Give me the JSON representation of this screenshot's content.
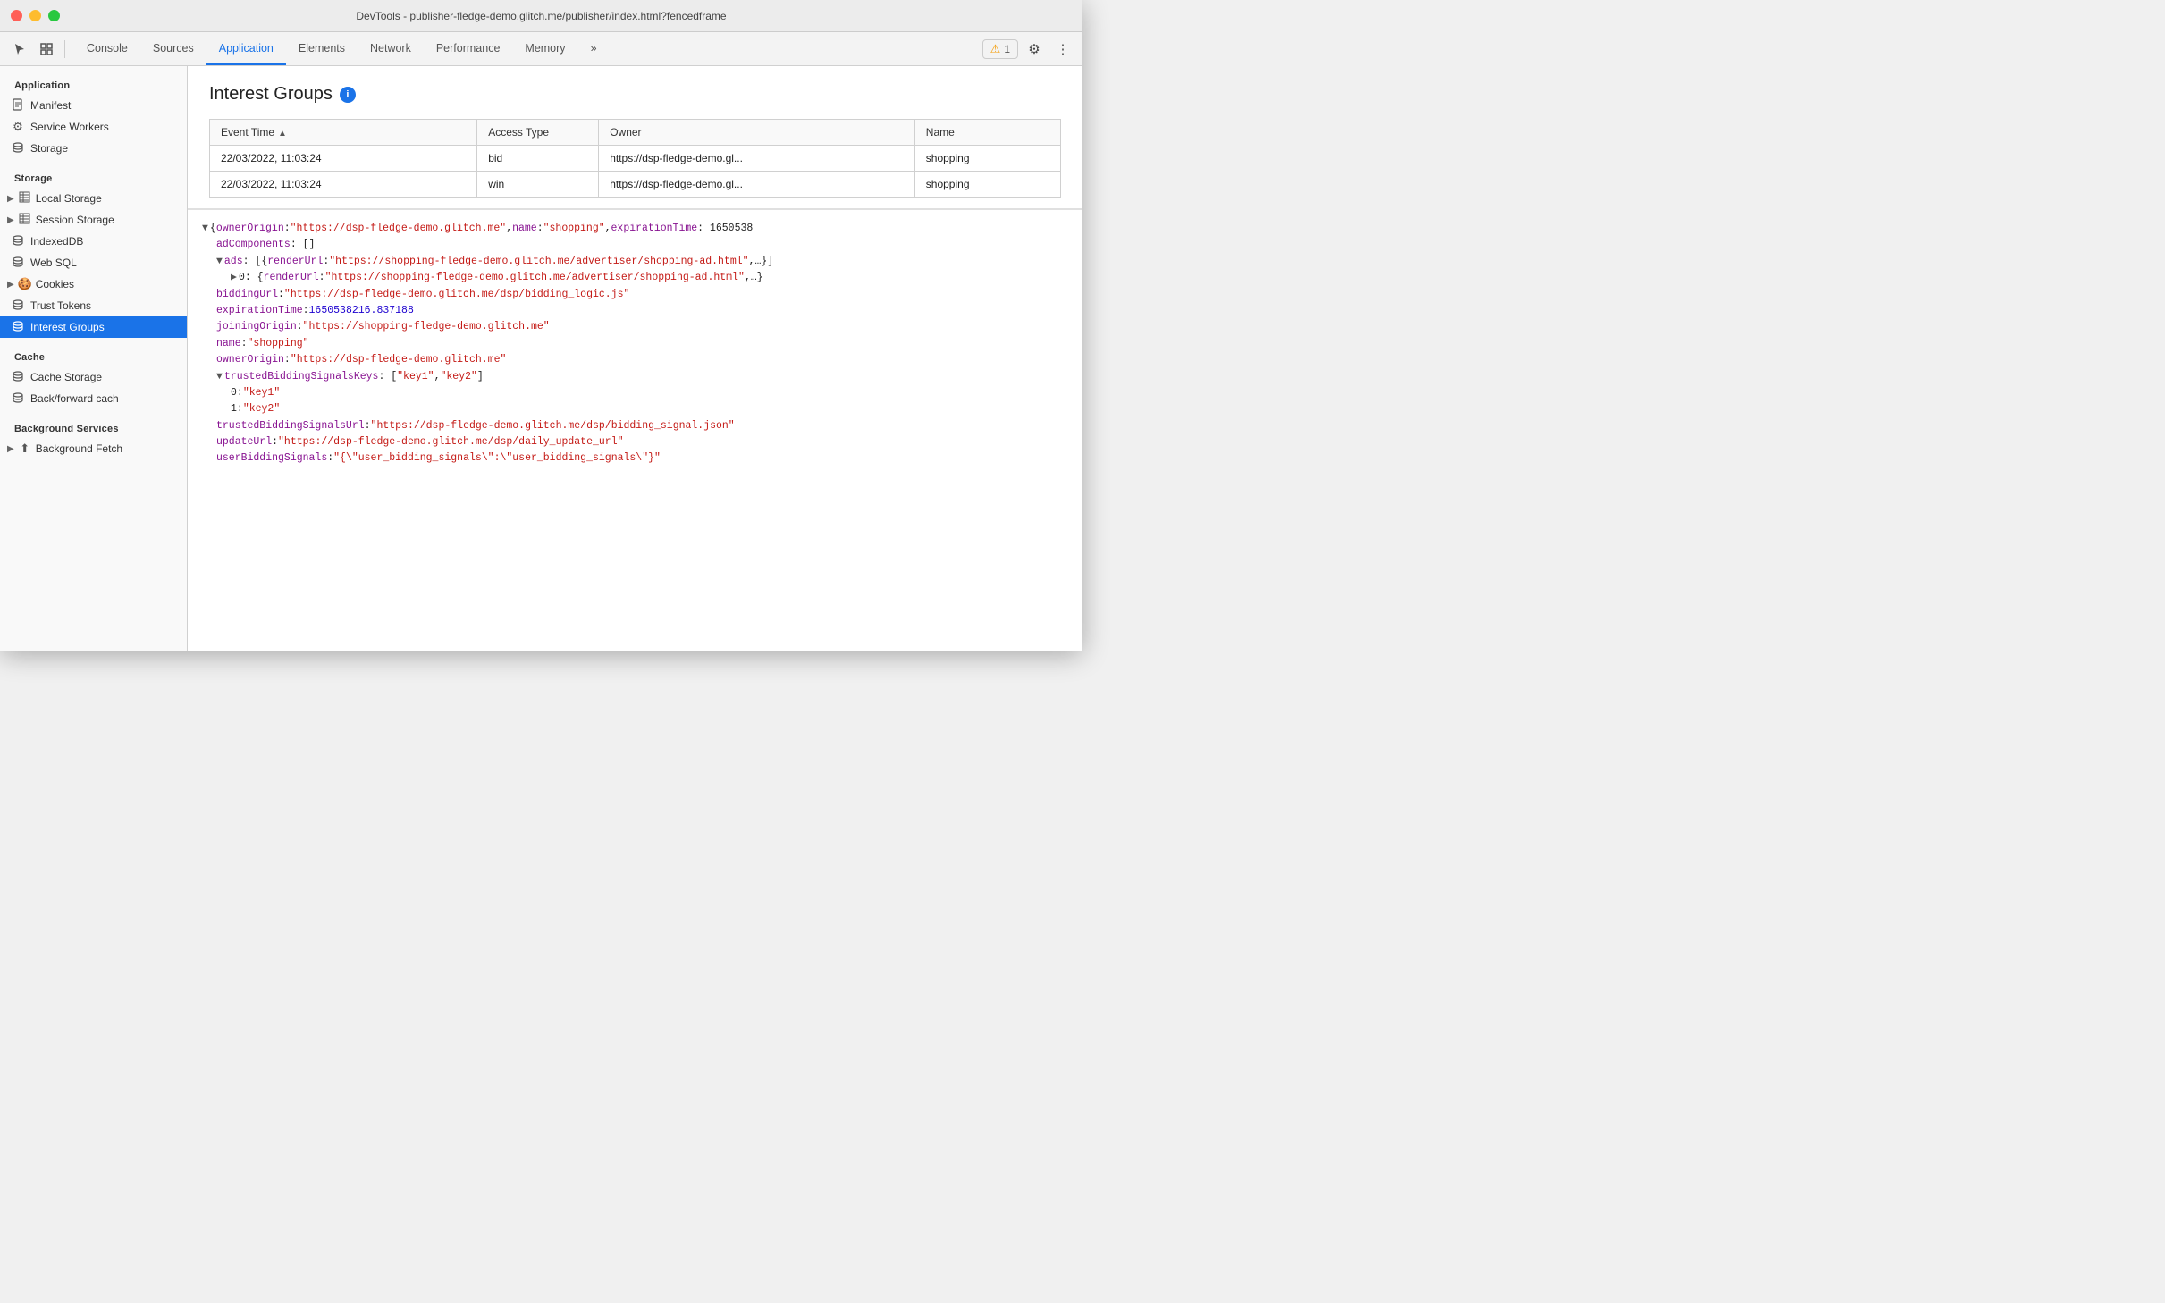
{
  "window": {
    "title": "DevTools - publisher-fledge-demo.glitch.me/publisher/index.html?fencedframe"
  },
  "toolbar": {
    "tabs": [
      {
        "label": "Console",
        "active": false
      },
      {
        "label": "Sources",
        "active": false
      },
      {
        "label": "Application",
        "active": true
      },
      {
        "label": "Elements",
        "active": false
      },
      {
        "label": "Network",
        "active": false
      },
      {
        "label": "Performance",
        "active": false
      },
      {
        "label": "Memory",
        "active": false
      }
    ],
    "more_label": "»",
    "warning_count": "1",
    "settings_icon": "⚙",
    "more_icon": "⋮"
  },
  "sidebar": {
    "sections": [
      {
        "title": "Application",
        "items": [
          {
            "label": "Manifest",
            "icon": "📄",
            "type": "plain"
          },
          {
            "label": "Service Workers",
            "icon": "⚙",
            "type": "plain"
          },
          {
            "label": "Storage",
            "icon": "🗄",
            "type": "plain"
          }
        ]
      },
      {
        "title": "Storage",
        "items": [
          {
            "label": "Local Storage",
            "icon": "▶",
            "type": "arrow",
            "icon2": "▦"
          },
          {
            "label": "Session Storage",
            "icon": "▶",
            "type": "arrow",
            "icon2": "▦"
          },
          {
            "label": "IndexedDB",
            "icon": "🗄",
            "type": "plain"
          },
          {
            "label": "Web SQL",
            "icon": "🗄",
            "type": "plain"
          },
          {
            "label": "Cookies",
            "icon": "▶",
            "type": "arrow",
            "icon2": "🍪"
          },
          {
            "label": "Trust Tokens",
            "icon": "🗄",
            "type": "plain"
          },
          {
            "label": "Interest Groups",
            "icon": "🗄",
            "type": "plain",
            "active": true
          }
        ]
      },
      {
        "title": "Cache",
        "items": [
          {
            "label": "Cache Storage",
            "icon": "🗄",
            "type": "plain"
          },
          {
            "label": "Back/forward cach",
            "icon": "🗄",
            "type": "plain"
          }
        ]
      },
      {
        "title": "Background Services",
        "items": [
          {
            "label": "Background Fetch",
            "icon": "▶",
            "type": "arrow-plain"
          }
        ]
      }
    ]
  },
  "interest_groups": {
    "title": "Interest Groups",
    "table": {
      "columns": [
        "Event Time",
        "Access Type",
        "Owner",
        "Name"
      ],
      "rows": [
        {
          "event_time": "22/03/2022, 11:03:24",
          "access_type": "bid",
          "owner": "https://dsp-fledge-demo.gl...",
          "name": "shopping"
        },
        {
          "event_time": "22/03/2022, 11:03:24",
          "access_type": "win",
          "owner": "https://dsp-fledge-demo.gl...",
          "name": "shopping"
        }
      ]
    },
    "detail": {
      "lines": [
        {
          "indent": 0,
          "type": "expand-open",
          "content": "{ownerOrigin: \"https://dsp-fledge-demo.glitch.me\", name: \"shopping\", expirationTime: 1650538"
        },
        {
          "indent": 1,
          "type": "key-plain",
          "key": "adComponents:",
          "value": " []"
        },
        {
          "indent": 1,
          "type": "expand-open",
          "key": "ads:",
          "value": " [{renderUrl: \"https://shopping-fledge-demo.glitch.me/advertiser/shopping-ad.html\",…}]"
        },
        {
          "indent": 2,
          "type": "expand-closed",
          "key": "▶ 0:",
          "value": " {renderUrl: \"https://shopping-fledge-demo.glitch.me/advertiser/shopping-ad.html\",…}"
        },
        {
          "indent": 1,
          "type": "key-url",
          "key": "biddingUrl:",
          "value": " \"https://dsp-fledge-demo.glitch.me/dsp/bidding_logic.js\""
        },
        {
          "indent": 1,
          "type": "key-number",
          "key": "expirationTime:",
          "value": " 1650538216.837188"
        },
        {
          "indent": 1,
          "type": "key-url",
          "key": "joiningOrigin:",
          "value": " \"https://shopping-fledge-demo.glitch.me\""
        },
        {
          "indent": 1,
          "type": "key-string",
          "key": "name:",
          "value": " \"shopping\""
        },
        {
          "indent": 1,
          "type": "key-string",
          "key": "ownerOrigin:",
          "value": " \"https://dsp-fledge-demo.glitch.me\""
        },
        {
          "indent": 1,
          "type": "expand-open",
          "key": "trustedBiddingSignalsKeys:",
          "value": " [\"key1\", \"key2\"]"
        },
        {
          "indent": 2,
          "type": "key-string",
          "key": "0:",
          "value": " \"key1\""
        },
        {
          "indent": 2,
          "type": "key-string",
          "key": "1:",
          "value": " \"key2\""
        },
        {
          "indent": 1,
          "type": "key-url",
          "key": "trustedBiddingSignalsUrl:",
          "value": " \"https://dsp-fledge-demo.glitch.me/dsp/bidding_signal.json\""
        },
        {
          "indent": 1,
          "type": "key-url",
          "key": "updateUrl:",
          "value": " \"https://dsp-fledge-demo.glitch.me/dsp/daily_update_url\""
        },
        {
          "indent": 1,
          "type": "key-string",
          "key": "userBiddingSignals:",
          "value": " \"{\\\"user_bidding_signals\\\":\\\"user_bidding_signals\\\"}\""
        }
      ]
    }
  }
}
